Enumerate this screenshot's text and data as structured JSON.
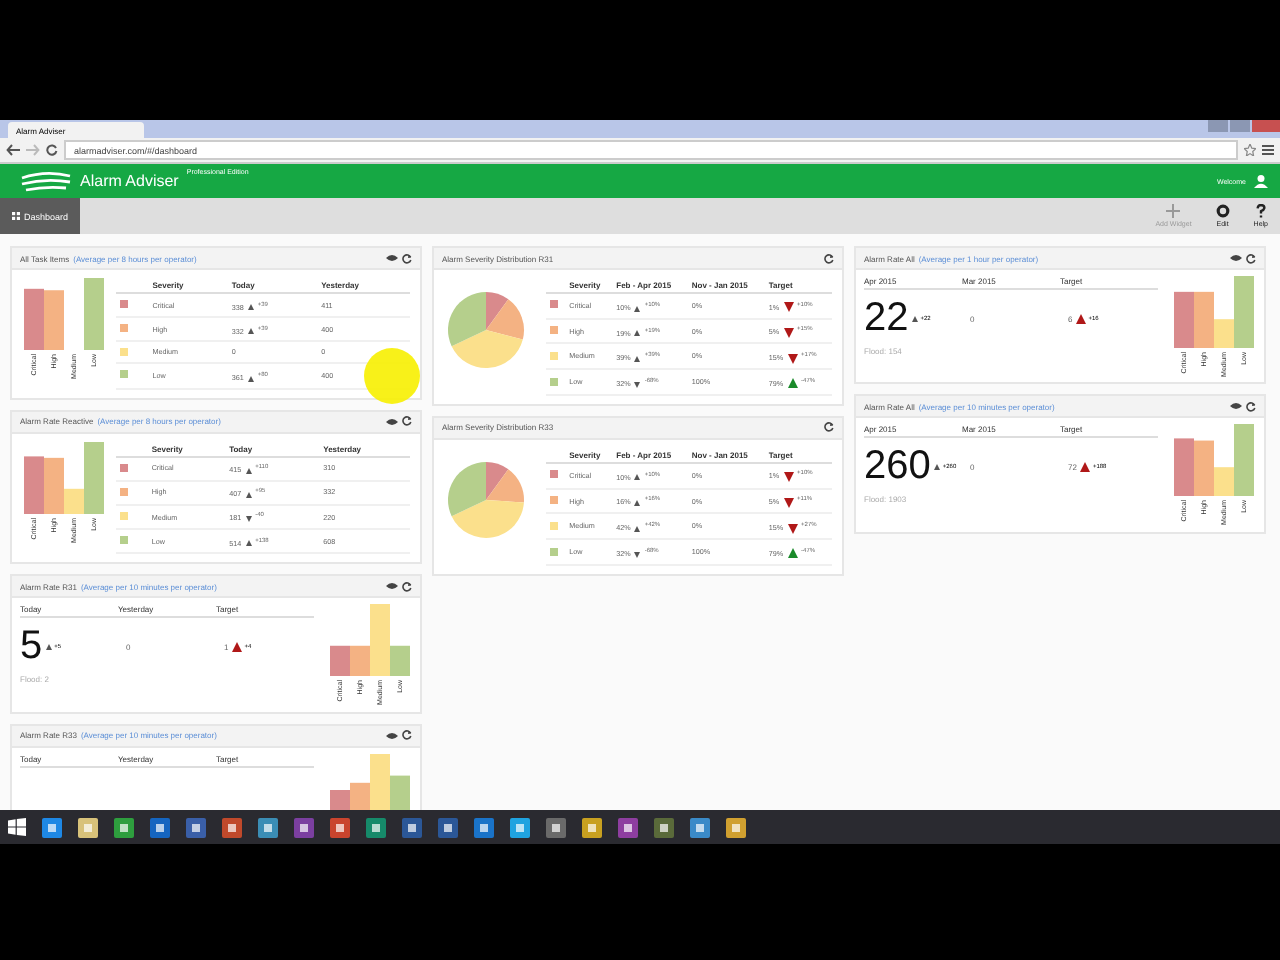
{
  "browser": {
    "tab_title": "Alarm Adviser",
    "url": "alarmadviser.com/#/dashboard"
  },
  "header": {
    "app_name": "Alarm Adviser",
    "edition": "Professional Edition",
    "user": "Welcome"
  },
  "toolbar": {
    "dashboard": "Dashboard",
    "actions": [
      {
        "label": "Add Widget",
        "kind": "add",
        "disabled": true
      },
      {
        "label": "Edit",
        "kind": "edit",
        "disabled": false
      },
      {
        "label": "Help",
        "kind": "help",
        "disabled": false
      }
    ]
  },
  "columns": [
    {
      "widgets": [
        {
          "kind": "table_bars",
          "title": "All Task Items",
          "hint": "(Average per 8 hours per operator)",
          "viewable": true,
          "headers": [
            "Severity",
            "Today",
            "Yesterday"
          ],
          "bar_labels": [
            "Critical",
            "High",
            "Medium",
            "Low"
          ],
          "rows": [
            {
              "label": "Critical",
              "color": "#d98a8c",
              "cells": [
                {
                  "text": "338",
                  "delta": "+39",
                  "rising": true,
                  "color": "#555555"
                },
                {
                  "text": "411"
                }
              ]
            },
            {
              "label": "High",
              "color": "#f4b283",
              "cells": [
                {
                  "text": "332",
                  "delta": "+39",
                  "rising": true,
                  "color": "#555555"
                },
                {
                  "text": "400"
                }
              ]
            },
            {
              "label": "Medium",
              "color": "#fbe08c",
              "cells": [
                {
                  "text": "0"
                },
                {
                  "text": "0"
                }
              ]
            },
            {
              "label": "Low",
              "color": "#b5cf8c",
              "cells": [
                {
                  "text": "361",
                  "delta": "+80",
                  "rising": true,
                  "color": "#555555"
                },
                {
                  "text": "400"
                }
              ]
            }
          ]
        },
        {
          "kind": "table_bars",
          "title": "Alarm Rate Reactive",
          "hint": "(Average per 8 hours per operator)",
          "viewable": true,
          "headers": [
            "Severity",
            "Today",
            "Yesterday"
          ],
          "bar_labels": [
            "Critical",
            "High",
            "Medium",
            "Low"
          ],
          "rows": [
            {
              "label": "Critical",
              "color": "#d98a8c",
              "cells": [
                {
                  "text": "415",
                  "delta": "+110",
                  "rising": true,
                  "color": "#555555"
                },
                {
                  "text": "310"
                }
              ]
            },
            {
              "label": "High",
              "color": "#f4b283",
              "cells": [
                {
                  "text": "407",
                  "delta": "+95",
                  "rising": true,
                  "color": "#555555"
                },
                {
                  "text": "332"
                }
              ]
            },
            {
              "label": "Medium",
              "color": "#fbe08c",
              "cells": [
                {
                  "text": "181",
                  "delta": "-40",
                  "rising": false,
                  "color": "#555555"
                },
                {
                  "text": "220"
                }
              ]
            },
            {
              "label": "Low",
              "color": "#b5cf8c",
              "cells": [
                {
                  "text": "514",
                  "delta": "+138",
                  "rising": true,
                  "color": "#555555"
                },
                {
                  "text": "608"
                }
              ]
            }
          ]
        },
        {
          "kind": "rate",
          "title": "Alarm Rate R31",
          "hint": "(Average per 10 minutes per operator)",
          "viewable": true,
          "headers": [
            "Today",
            "Yesterday",
            "Target"
          ],
          "main": {
            "text": "5",
            "delta": "+5",
            "rising": true,
            "color": "#555555"
          },
          "previous": {
            "text": "0"
          },
          "target": {
            "text": "1",
            "delta": "+4",
            "rising": true,
            "color": "#b01818"
          },
          "footer": "Flood: 2",
          "bar_labels": [
            "Critical",
            "High",
            "Medium",
            "Low"
          ]
        },
        {
          "kind": "rate",
          "title": "Alarm Rate R33",
          "hint": "(Average per 10 minutes per operator)",
          "viewable": true,
          "headers": [
            "Today",
            "Yesterday",
            "Target"
          ]
        }
      ]
    },
    {
      "widgets": [
        {
          "kind": "table_pie",
          "title": "Alarm Severity Distribution R31",
          "viewable": false,
          "headers": [
            "Severity",
            "Feb - Apr 2015",
            "Nov - Jan 2015",
            "Target"
          ],
          "rows": [
            {
              "label": "Critical",
              "color": "#d98a8c",
              "cells": [
                {
                  "text": "10%",
                  "delta": "+10%",
                  "rising": true,
                  "color": "#555555"
                },
                {
                  "text": "0%"
                },
                {
                  "text": "1%",
                  "delta": "+10%",
                  "rising": false,
                  "color": "#b01818"
                }
              ]
            },
            {
              "label": "High",
              "color": "#f4b283",
              "cells": [
                {
                  "text": "19%",
                  "delta": "+19%",
                  "rising": true,
                  "color": "#555555"
                },
                {
                  "text": "0%"
                },
                {
                  "text": "5%",
                  "delta": "+15%",
                  "rising": false,
                  "color": "#b01818"
                }
              ]
            },
            {
              "label": "Medium",
              "color": "#fbe08c",
              "cells": [
                {
                  "text": "39%",
                  "delta": "+39%",
                  "rising": true,
                  "color": "#555555"
                },
                {
                  "text": "0%"
                },
                {
                  "text": "15%",
                  "delta": "+17%",
                  "rising": false,
                  "color": "#b01818"
                }
              ]
            },
            {
              "label": "Low",
              "color": "#b5cf8c",
              "cells": [
                {
                  "text": "32%",
                  "delta": "-68%",
                  "rising": false,
                  "color": "#555555"
                },
                {
                  "text": "100%"
                },
                {
                  "text": "79%",
                  "delta": "-47%",
                  "rising": true,
                  "color": "#1a8a2a"
                }
              ]
            }
          ]
        },
        {
          "kind": "table_pie",
          "title": "Alarm Severity Distribution R33",
          "viewable": false,
          "headers": [
            "Severity",
            "Feb - Apr 2015",
            "Nov - Jan 2015",
            "Target"
          ],
          "rows": [
            {
              "label": "Critical",
              "color": "#d98a8c",
              "cells": [
                {
                  "text": "10%",
                  "delta": "+10%",
                  "rising": true,
                  "color": "#555555"
                },
                {
                  "text": "0%"
                },
                {
                  "text": "1%",
                  "delta": "+10%",
                  "rising": false,
                  "color": "#b01818"
                }
              ]
            },
            {
              "label": "High",
              "color": "#f4b283",
              "cells": [
                {
                  "text": "16%",
                  "delta": "+16%",
                  "rising": true,
                  "color": "#555555"
                },
                {
                  "text": "0%"
                },
                {
                  "text": "5%",
                  "delta": "+11%",
                  "rising": false,
                  "color": "#b01818"
                }
              ]
            },
            {
              "label": "Medium",
              "color": "#fbe08c",
              "cells": [
                {
                  "text": "42%",
                  "delta": "+42%",
                  "rising": true,
                  "color": "#555555"
                },
                {
                  "text": "0%"
                },
                {
                  "text": "15%",
                  "delta": "+27%",
                  "rising": false,
                  "color": "#b01818"
                }
              ]
            },
            {
              "label": "Low",
              "color": "#b5cf8c",
              "cells": [
                {
                  "text": "32%",
                  "delta": "-68%",
                  "rising": false,
                  "color": "#555555"
                },
                {
                  "text": "100%"
                },
                {
                  "text": "79%",
                  "delta": "-47%",
                  "rising": true,
                  "color": "#1a8a2a"
                }
              ]
            }
          ]
        }
      ]
    },
    {
      "widgets": [
        {
          "kind": "rate",
          "title": "Alarm Rate All",
          "hint": "(Average per 1 hour per operator)",
          "viewable": true,
          "headers": [
            "Apr 2015",
            "Mar 2015",
            "Target"
          ],
          "main": {
            "text": "22",
            "delta": "+22",
            "rising": true,
            "color": "#555555"
          },
          "previous": {
            "text": "0"
          },
          "target": {
            "text": "6",
            "delta": "+16",
            "rising": true,
            "color": "#b01818"
          },
          "footer": "Flood: 154",
          "bar_labels": [
            "Critical",
            "High",
            "Medium",
            "Low"
          ]
        },
        {
          "kind": "rate",
          "title": "Alarm Rate All",
          "hint": "(Average per 10 minutes per operator)",
          "viewable": true,
          "headers": [
            "Apr 2015",
            "Mar 2015",
            "Target"
          ],
          "main": {
            "text": "260",
            "delta": "+260",
            "rising": true,
            "color": "#555555"
          },
          "previous": {
            "text": "0"
          },
          "target": {
            "text": "72",
            "delta": "+188",
            "rising": true,
            "color": "#b01818"
          },
          "footer": "Flood: 1903",
          "bar_labels": [
            "Critical",
            "High",
            "Medium",
            "Low"
          ]
        }
      ]
    }
  ]
}
